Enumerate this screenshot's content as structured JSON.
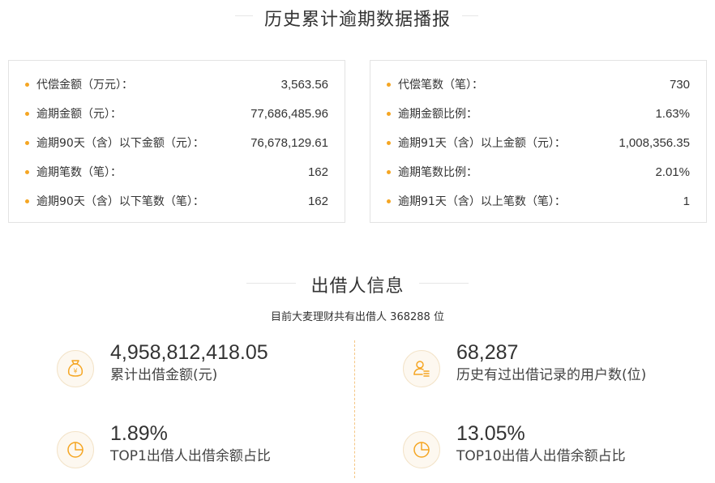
{
  "overdue": {
    "title": "历史累计逾期数据播报",
    "left_rows": [
      {
        "label": "代偿金额（万元）：",
        "value": "3,563.56"
      },
      {
        "label": "逾期金额（元）：",
        "value": "77,686,485.96"
      },
      {
        "label": "逾期90天（含）以下金额（元）：",
        "value": "76,678,129.61"
      },
      {
        "label": "逾期笔数（笔）：",
        "value": "162"
      },
      {
        "label": "逾期90天（含）以下笔数（笔）：",
        "value": "162"
      }
    ],
    "right_rows": [
      {
        "label": "代偿笔数（笔）：",
        "value": "730"
      },
      {
        "label": "逾期金额比例：",
        "value": "1.63%"
      },
      {
        "label": "逾期91天（含）以上金额（元）：",
        "value": "1,008,356.35"
      },
      {
        "label": "逾期笔数比例：",
        "value": "2.01%"
      },
      {
        "label": "逾期91天（含）以上笔数（笔）：",
        "value": "1"
      }
    ]
  },
  "lenders": {
    "title": "出借人信息",
    "subtitle": "目前大麦理财共有出借人 368288 位",
    "stats": [
      {
        "value": "4,958,812,418.05",
        "label": "累计出借金额(元)",
        "icon": "money-bag-icon"
      },
      {
        "value": "68,287",
        "label": "历史有过出借记录的用户数(位)",
        "icon": "user-coins-icon"
      },
      {
        "value": "1.89%",
        "label": "TOP1出借人出借余额占比",
        "icon": "pie-chart-icon"
      },
      {
        "value": "13.05%",
        "label": "TOP10出借人出借余额占比",
        "icon": "pie-chart-icon"
      }
    ]
  },
  "colors": {
    "accent": "#f5a623",
    "icon_bg": "#fdf8f0"
  }
}
